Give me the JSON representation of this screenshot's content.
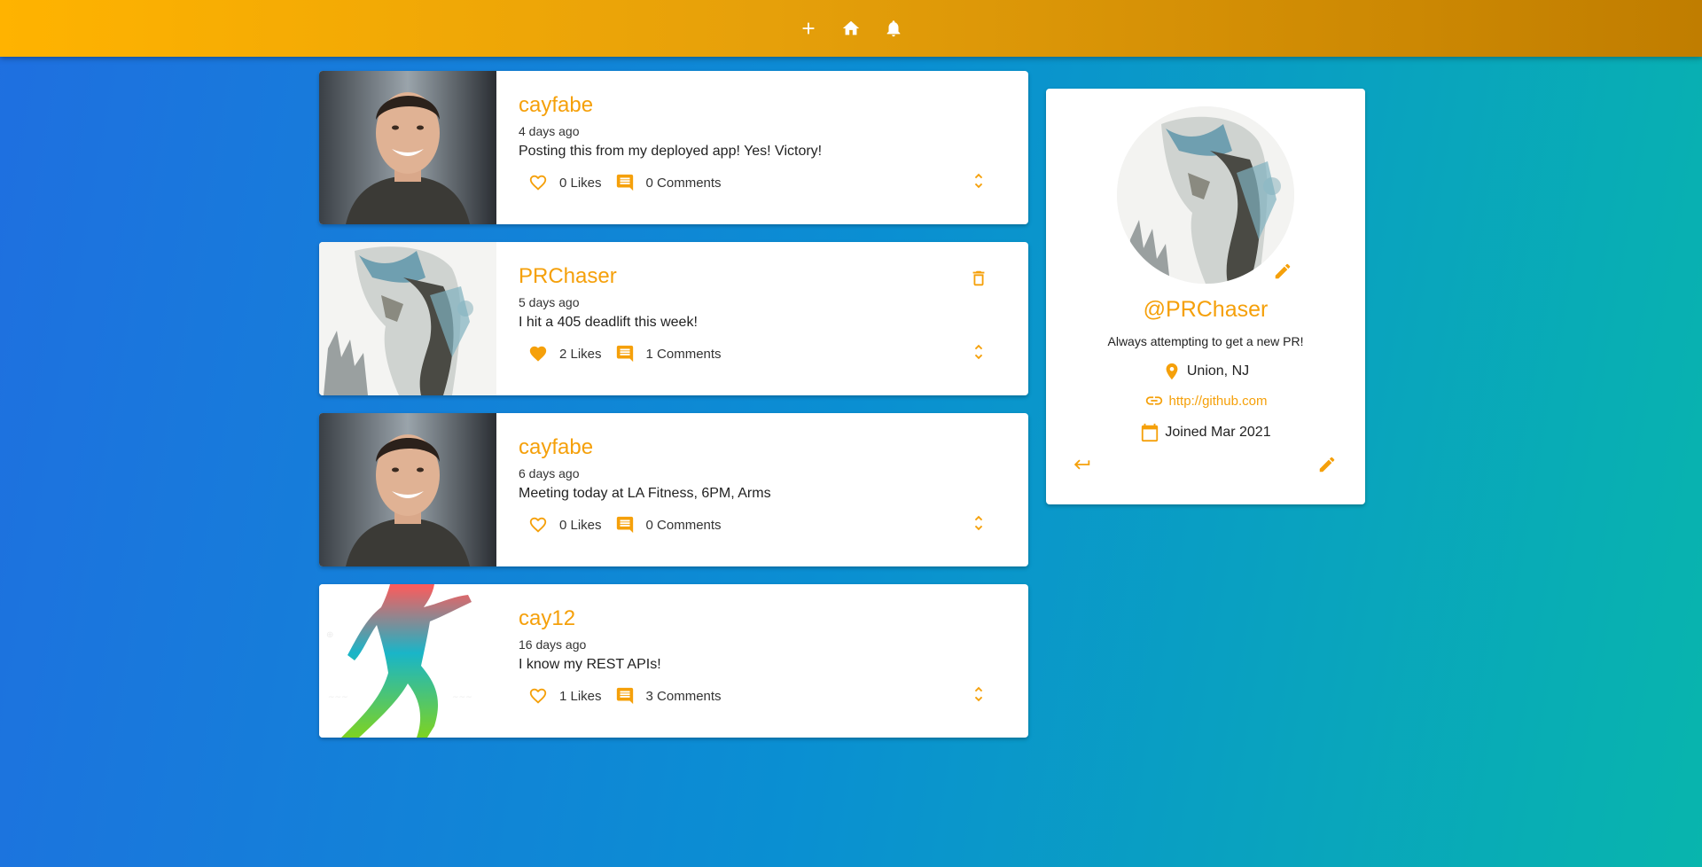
{
  "appbar": {
    "icons": [
      "add-icon",
      "home-icon",
      "notifications-icon"
    ]
  },
  "posts": [
    {
      "handle": "cayfabe",
      "ago": "4 days ago",
      "body": "Posting this from my deployed app! Yes! Victory!",
      "likes": "0 Likes",
      "comments": "0 Comments",
      "liked": false,
      "image": "man-smiling-portrait"
    },
    {
      "handle": "PRChaser",
      "ago": "5 days ago",
      "body": "I hit a 405 deadlift this week!",
      "likes": "2 Likes",
      "comments": "1 Comments",
      "liked": true,
      "image": "sketch-art-profile"
    },
    {
      "handle": "cayfabe",
      "ago": "6 days ago",
      "body": "Meeting today at LA Fitness, 6PM, Arms",
      "likes": "0 Likes",
      "comments": "0 Comments",
      "liked": false,
      "image": "man-smiling-portrait"
    },
    {
      "handle": "cay12",
      "ago": "16 days ago",
      "body": "I know my REST APIs!",
      "likes": "1 Likes",
      "comments": "3 Comments",
      "liked": false,
      "image": "gradient-runner"
    }
  ],
  "profile": {
    "handle": "@PRChaser",
    "bio": "Always attempting to get a new PR!",
    "location": "Union, NJ",
    "website": "http://github.com",
    "joined": "Joined Mar 2021"
  },
  "colors": {
    "accent": "#f5a00a",
    "appbar_start": "#ffb300",
    "appbar_end": "#c07d00",
    "bg_start": "#1f6fe0",
    "bg_end": "#08b5ad"
  }
}
